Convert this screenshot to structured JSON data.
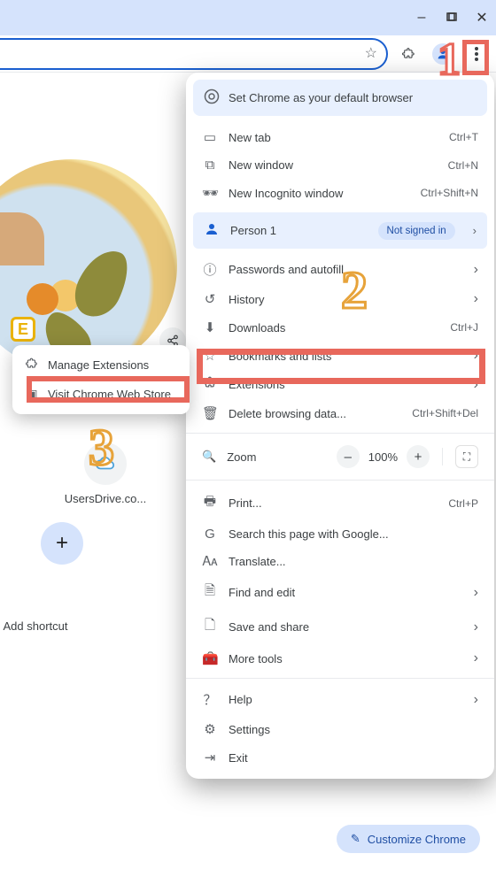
{
  "window_controls": {
    "minimize": "–",
    "maximize": "▢",
    "close": "✕"
  },
  "toolbar": {
    "star_tooltip": "Bookmark",
    "extensions_icon": "extensions",
    "profile_icon": "person"
  },
  "default_banner": {
    "text": "Set Chrome as your default browser"
  },
  "menu": {
    "new_tab": "New tab",
    "new_tab_sc": "Ctrl+T",
    "new_window": "New window",
    "new_window_sc": "Ctrl+N",
    "incognito": "New Incognito window",
    "incognito_sc": "Ctrl+Shift+N",
    "person": "Person 1",
    "person_status": "Not signed in",
    "passwords": "Passwords and autofill",
    "history": "History",
    "downloads": "Downloads",
    "downloads_sc": "Ctrl+J",
    "bookmarks": "Bookmarks and lists",
    "extensions": "Extensions",
    "delete_browsing": "Delete browsing data...",
    "delete_browsing_sc": "Ctrl+Shift+Del",
    "zoom_label": "Zoom",
    "zoom_value": "100%",
    "print": "Print...",
    "print_sc": "Ctrl+P",
    "search_google": "Search this page with Google...",
    "translate": "Translate...",
    "find": "Find and edit",
    "save_share": "Save and share",
    "more_tools": "More tools",
    "help": "Help",
    "settings": "Settings",
    "exit": "Exit"
  },
  "ext_popover": {
    "manage": "Manage Extensions",
    "visit_store": "Visit Chrome Web Store"
  },
  "ntp": {
    "tile1_label": "UsersDrive.co...",
    "add_shortcut": "Add shortcut"
  },
  "customize_btn": "Customize Chrome",
  "annotations": {
    "one": "1",
    "two": "2",
    "three": "3"
  }
}
